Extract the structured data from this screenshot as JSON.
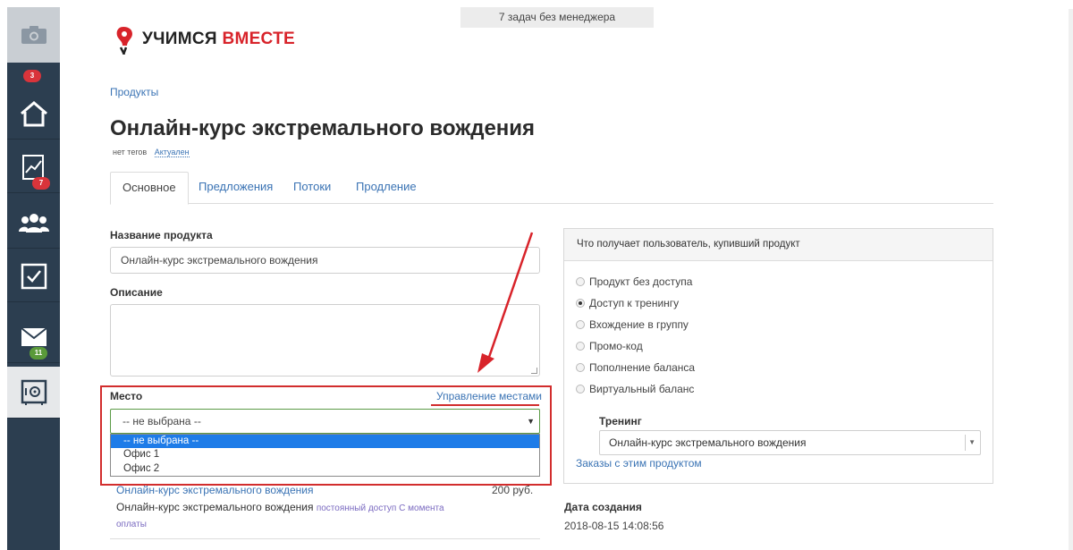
{
  "sidebar": {
    "badges": {
      "home": "3",
      "stats": "7",
      "mail": "11"
    },
    "icons": [
      "camera-icon",
      "home-icon",
      "chart-icon",
      "users-icon",
      "checkbox-icon",
      "mail-icon",
      "safe-icon"
    ]
  },
  "notice": "7 задач без менеджера",
  "logo": {
    "part1": "УЧИМСЯ",
    "part2": "ВМЕСТЕ"
  },
  "breadcrumb": "Продукты",
  "title": "Онлайн-курс экстремального вождения",
  "tags": {
    "text": "нет тегов",
    "status": "Актуален"
  },
  "tabs": [
    "Основное",
    "Предложения",
    "Потоки",
    "Продление"
  ],
  "form": {
    "name_label": "Название продукта",
    "name_value": "Онлайн-курс экстремального вождения",
    "desc_label": "Описание",
    "place_label": "Место",
    "manage_places": "Управление местами",
    "place_selected": "-- не выбрана --",
    "place_options": [
      "-- не выбрана --",
      "Офис 1",
      "Офис 2"
    ]
  },
  "offer": {
    "name": "Онлайн-курс экстремального вождения",
    "price": "200 руб.",
    "desc": "Онлайн-курс экстремального вождения",
    "access": "постоянный доступ С момента оплаты"
  },
  "panel": {
    "header": "Что получает пользователь, купивший продукт",
    "options": [
      "Продукт без доступа",
      "Доступ к тренингу",
      "Вхождение в группу",
      "Промо-код",
      "Пополнение баланса",
      "Виртуальный баланс"
    ],
    "selected_index": 1,
    "training_label": "Тренинг",
    "training_value": "Онлайн-курс экстремального вождения",
    "orders_link": "Заказы с этим продуктом"
  },
  "created": {
    "label": "Дата создания",
    "value": "2018-08-15 14:08:56"
  },
  "colors": {
    "accent": "#3a73b4",
    "highlight": "#d22d2d",
    "sidebar": "#2c3e50"
  }
}
